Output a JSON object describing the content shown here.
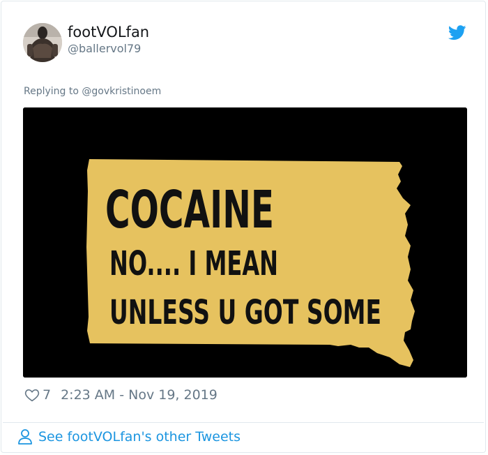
{
  "tweet": {
    "display_name": "footVOLfan",
    "handle": "@ballervol79",
    "replying_prefix": "Replying to ",
    "replying_to": "@govkristinoem",
    "media": {
      "lines": [
        "COCAINE",
        "NO.... I MEAN",
        "UNLESS U GOT SOME"
      ],
      "background_color": "#000000",
      "shape_color": "#e6c25f",
      "text_color": "#111111"
    },
    "likes": "7",
    "timestamp": "2:23 AM - Nov 19, 2019",
    "icons": {
      "brand": "twitter-bird-icon",
      "like": "heart-icon",
      "profile": "person-icon"
    },
    "colors": {
      "accent": "#1da1f2",
      "link": "#1b95e0",
      "muted": "#657786"
    }
  },
  "footer": {
    "link_label": "See footVOLfan's other Tweets"
  }
}
